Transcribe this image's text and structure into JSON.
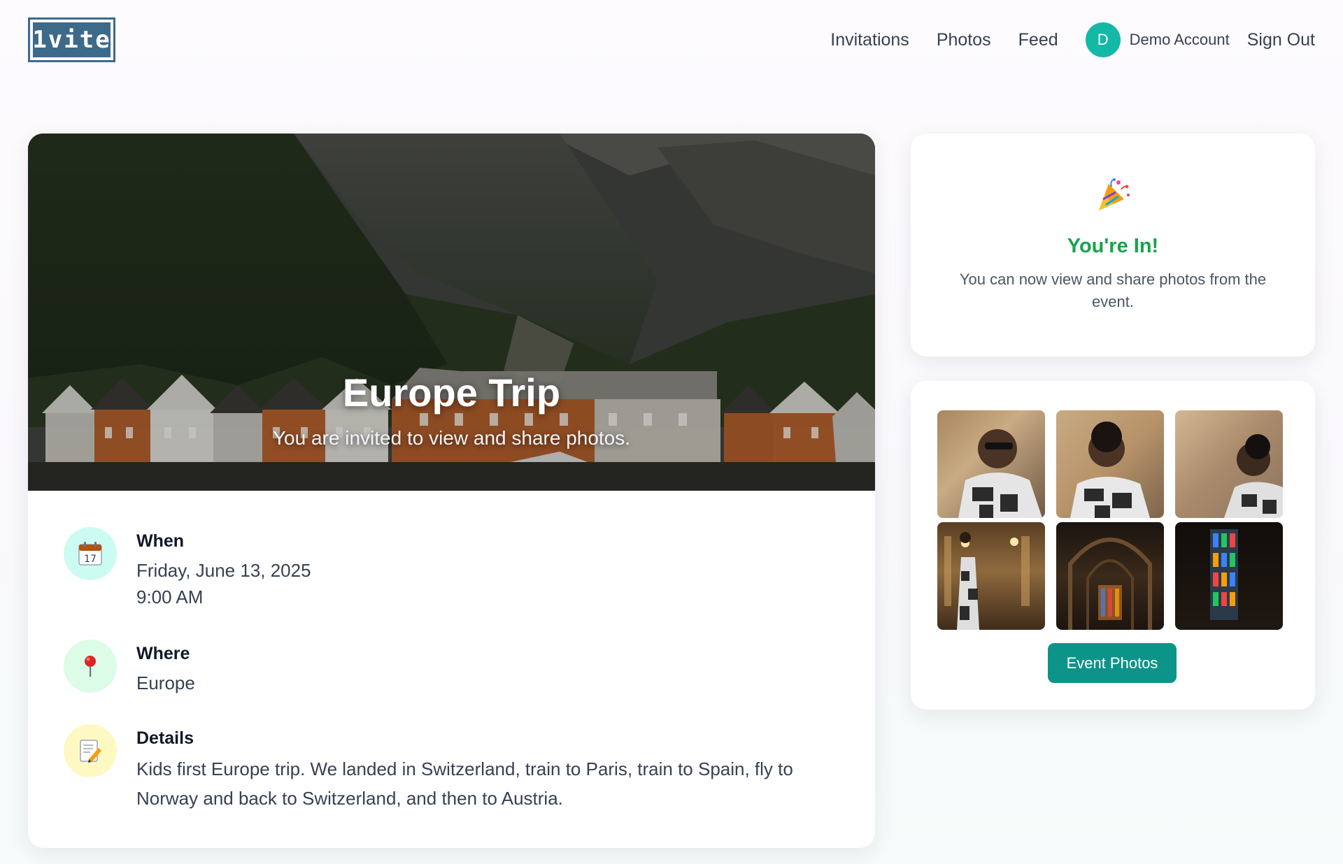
{
  "header": {
    "logo_text": "1vite",
    "nav": [
      "Invitations",
      "Photos",
      "Feed"
    ],
    "account": {
      "initial": "D",
      "name": "Demo Account"
    },
    "sign_out": "Sign Out"
  },
  "event": {
    "title": "Europe Trip",
    "subtitle": "You are invited to view and share photos.",
    "when": {
      "label": "When",
      "date": "Friday, June 13, 2025",
      "time": "9:00 AM",
      "icon": "calendar-icon"
    },
    "where": {
      "label": "Where",
      "place": "Europe",
      "icon": "pushpin-icon"
    },
    "details": {
      "label": "Details",
      "text": "Kids first Europe trip. We landed in Switzerland, train to Paris, train to Spain, fly to Norway and back to Switzerland, and then to Austria.",
      "icon": "memo-icon"
    },
    "calendar_day": "17"
  },
  "status": {
    "icon": "party-popper-icon",
    "title": "You're In!",
    "message": "You can now view and share photos from the event."
  },
  "photos": {
    "button_label": "Event Photos",
    "count": 6
  },
  "colors": {
    "brand": "#3e6a8a",
    "accent": "#0d9488",
    "avatar": "#14b8a6",
    "success": "#16a34a"
  }
}
